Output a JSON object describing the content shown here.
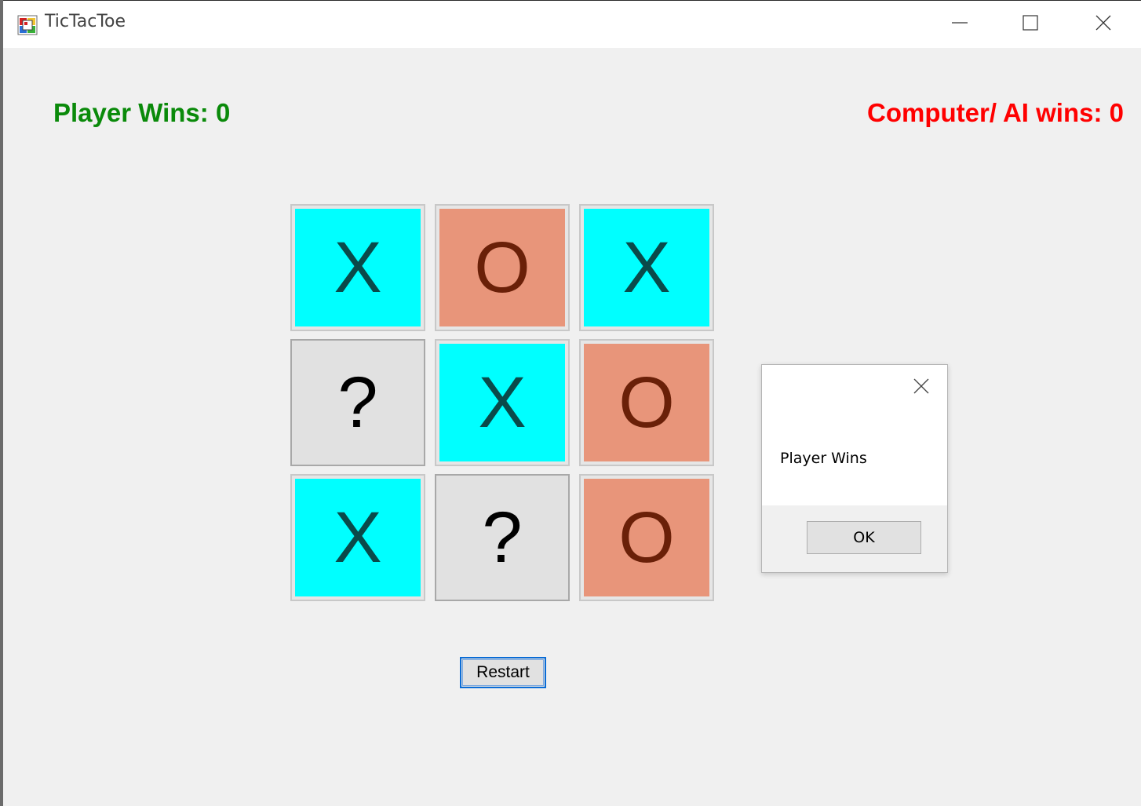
{
  "window": {
    "title": "TicTacToe",
    "icon": "app-window-icon",
    "controls": [
      "minimize-icon",
      "maximize-icon",
      "close-icon"
    ]
  },
  "scores": {
    "player": "Player Wins: 0",
    "computer": "Computer/ AI wins: 0"
  },
  "board": {
    "cells": [
      {
        "mark": "X",
        "state": "x"
      },
      {
        "mark": "O",
        "state": "o"
      },
      {
        "mark": "X",
        "state": "x"
      },
      {
        "mark": "?",
        "state": "q"
      },
      {
        "mark": "X",
        "state": "x"
      },
      {
        "mark": "O",
        "state": "o"
      },
      {
        "mark": "X",
        "state": "x"
      },
      {
        "mark": "?",
        "state": "q"
      },
      {
        "mark": "O",
        "state": "o"
      }
    ],
    "colors": {
      "x_bg": "#00ffff",
      "x_fg": "#0a4a4a",
      "o_bg": "#e8957a",
      "o_fg": "#6a2008",
      "empty_bg": "#e1e1e1"
    }
  },
  "restart_label": "Restart",
  "dialog": {
    "message": "Player Wins",
    "ok_label": "OK"
  },
  "colors": {
    "player_score": "#0a8a0a",
    "computer_score": "#ff0000",
    "focus_accent": "#0a6cd6"
  }
}
